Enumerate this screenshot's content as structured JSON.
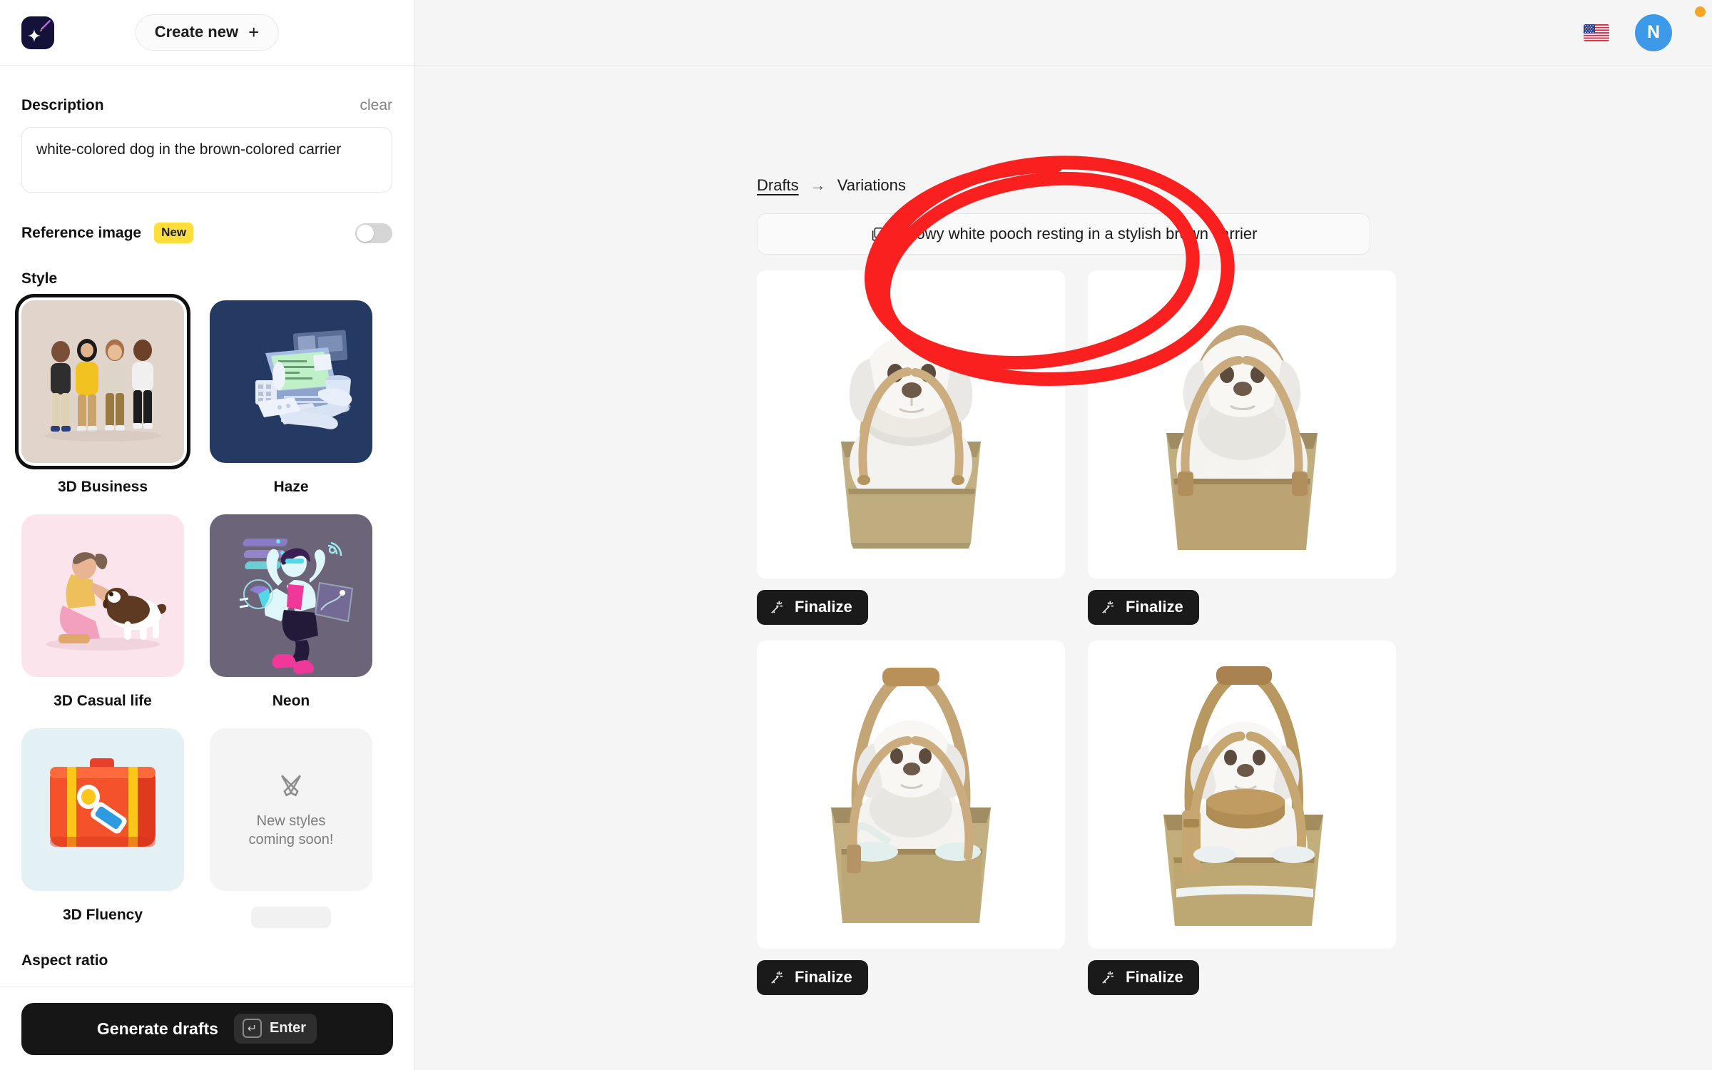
{
  "sidebar": {
    "logo_icon": "sparkle-brush-logo",
    "create_new_label": "Create new",
    "create_new_icon": "plus-icon",
    "description": {
      "label": "Description",
      "clear_label": "clear",
      "value": "white-colored dog in the brown-colored carrier"
    },
    "reference_image": {
      "label": "Reference image",
      "badge": "New",
      "toggle_state": "off"
    },
    "style": {
      "label": "Style",
      "items": [
        {
          "label": "3D Business",
          "selected": true,
          "bg": "#e0d4cb"
        },
        {
          "label": "Haze",
          "selected": false,
          "bg": "#243a63"
        },
        {
          "label": "3D Casual life",
          "selected": false,
          "bg": "#fbe4ec"
        },
        {
          "label": "Neon",
          "selected": false,
          "bg": "#6c6478"
        },
        {
          "label": "3D Fluency",
          "selected": false,
          "bg": "#e3f1f4"
        }
      ],
      "coming_soon_text_line1": "New styles",
      "coming_soon_text_line2": "coming soon!",
      "coming_soon_icon": "crossed-pens-icon"
    },
    "aspect_ratio": {
      "label": "Aspect ratio"
    },
    "footer": {
      "generate_label": "Generate drafts",
      "shortcut_label": "Enter",
      "shortcut_icon": "enter-key-icon"
    }
  },
  "header": {
    "locale_icon": "us-flag-icon",
    "avatar_initial": "N",
    "avatar_color": "#3d9ae8",
    "notification_dot_color": "#f5a623"
  },
  "main": {
    "breadcrumb": {
      "parent": "Drafts",
      "arrow": "→",
      "current": "Variations"
    },
    "prompt": {
      "icon": "copy-icon",
      "text": "Snowy white pooch resting in a stylish brown carrier"
    },
    "cards": [
      {
        "id": 1,
        "finalize_label": "Finalize",
        "finalize_icon": "magic-wand-icon",
        "annotated": true
      },
      {
        "id": 2,
        "finalize_label": "Finalize",
        "finalize_icon": "magic-wand-icon",
        "annotated": false
      },
      {
        "id": 3,
        "finalize_label": "Finalize",
        "finalize_icon": "magic-wand-icon",
        "annotated": false
      },
      {
        "id": 4,
        "finalize_label": "Finalize",
        "finalize_icon": "magic-wand-icon",
        "annotated": false
      }
    ],
    "annotation": {
      "type": "hand-drawn-ellipse",
      "color": "#fb2020",
      "target_card": 1
    }
  }
}
